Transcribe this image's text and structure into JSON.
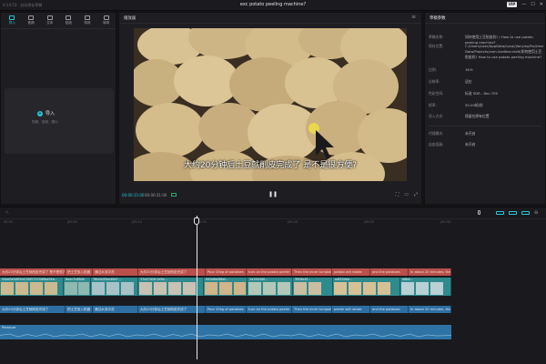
{
  "window": {
    "left_text": "0:14:53 · 自动保存草稿",
    "title": "exc potato peeling machine?",
    "vip": "VIP",
    "controls": [
      "—",
      "☐",
      "✕"
    ]
  },
  "media_panel": {
    "tools": [
      {
        "label": "导入",
        "icon": "media-icon"
      },
      {
        "label": "音频",
        "icon": "audio-icon"
      },
      {
        "label": "文本",
        "icon": "text-icon"
      },
      {
        "label": "贴纸",
        "icon": "sticker-icon"
      },
      {
        "label": "特效",
        "icon": "effects-icon"
      },
      {
        "label": "转场",
        "icon": "transition-icon"
      },
      {
        "label": "滤镜",
        "icon": "filter-icon"
      }
    ],
    "import_label": "导入",
    "import_hint": "视频、音频、图片"
  },
  "player": {
    "header": "播放器",
    "subtitle": "大约20分钟后土豆就削皮完成了 是不是很方便?",
    "current_time": "00:00:15:00",
    "total_time": "00:00:31:00"
  },
  "properties": {
    "header": "草稿参数",
    "rows": [
      {
        "label": "草稿名称:",
        "value": "如何使用土豆削皮机? / How to use potato peeling machine?"
      },
      {
        "label": "保存位置:",
        "value": "C:/Users/user/AppData/Local/JianyingPro/User Data/Projects/com.lveditor.draft/如何使用土豆削皮机? How to use potato peeling machine?"
      },
      {
        "label": "比例:",
        "value": "16:9"
      },
      {
        "label": "分辨率:",
        "value": "适应"
      },
      {
        "label": "色彩空间:",
        "value": "标准 SDR - Rec.709"
      },
      {
        "label": "帧率:",
        "value": "30.00帧/秒"
      },
      {
        "label": "导入方式:",
        "value": "保留在原有位置"
      },
      {
        "label": "代理模式:",
        "value": "未开启"
      },
      {
        "label": "自由层级:",
        "value": "未开启"
      }
    ]
  },
  "timeline": {
    "ruler": [
      "00:00",
      "|00:05",
      "|00:10",
      "|00:15",
      "|00:20",
      "|00:25",
      "|00:30"
    ],
    "caption_track": [
      "大约20分钟后土豆就削皮完成了 是不是很方便?",
      "把土豆放入机器",
      "通过水流冲洗",
      "大约20分钟后土豆就削皮完成了",
      "Pour 20kg of potatoes",
      "turn on the potato peeler",
      "Then the inner turnplate",
      "potato will rotate",
      "and the potatoes",
      "In about 20 minutes, the potatoes"
    ],
    "video_track": [
      "04ae0e5d95e429057225d9ba94a...",
      "8aec7c68d4",
      "78b0a35ee48d7...",
      "17a17d1fc1e9a...",
      "000d6a5f8af...",
      "1a194440...",
      "3906c4f...",
      "a4f554ee...",
      "e6bd..."
    ],
    "caption2_track": [
      "大约20分钟后土豆就削皮完成了",
      "把土豆放入机器",
      "通过水流冲洗",
      "大约20分钟后土豆就削皮完成了",
      "Pour 20kg of potatoes",
      "turn on the potato peeler",
      "Then the inner turnplate",
      "peeler will rotate",
      "and the potatoes",
      "In about 20 minutes, the potatoes"
    ],
    "audio_label": "Pleasure"
  }
}
